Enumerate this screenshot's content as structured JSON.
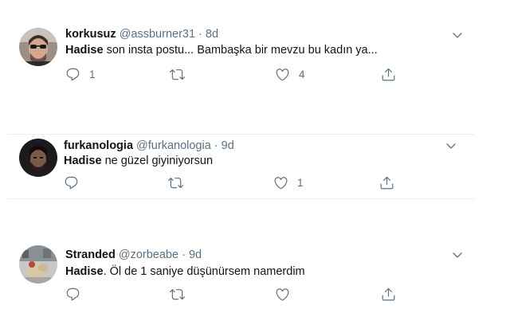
{
  "tweets": [
    {
      "name": "korkusuz",
      "handle": "@assburner31",
      "time": "8d",
      "mention": "Hadise",
      "text": " son insta postu... Bambaşka bir mevzu bu kadın ya...",
      "reply_count": "1",
      "retweet_count": "",
      "like_count": "4"
    },
    {
      "name": "furkanologia",
      "handle": "@furkanologia",
      "time": "9d",
      "mention": "Hadise",
      "text": " ne güzel giyiniyorsun",
      "reply_count": "",
      "retweet_count": "",
      "like_count": "1"
    },
    {
      "name": "Stranded",
      "handle": "@zorbeabe",
      "time": "9d",
      "mention": "Hadise",
      "text": ". Öl de 1 saniye düşünürsem namerdim",
      "reply_count": "",
      "retweet_count": "",
      "like_count": ""
    }
  ],
  "separator": " · ",
  "icons": {
    "reply": "reply-icon",
    "retweet": "retweet-icon",
    "like": "heart-icon",
    "share": "share-icon",
    "more": "chevron-down-icon"
  },
  "colors": {
    "muted": "#5b7083",
    "text": "#0f1419",
    "border": "#ebeef0"
  }
}
